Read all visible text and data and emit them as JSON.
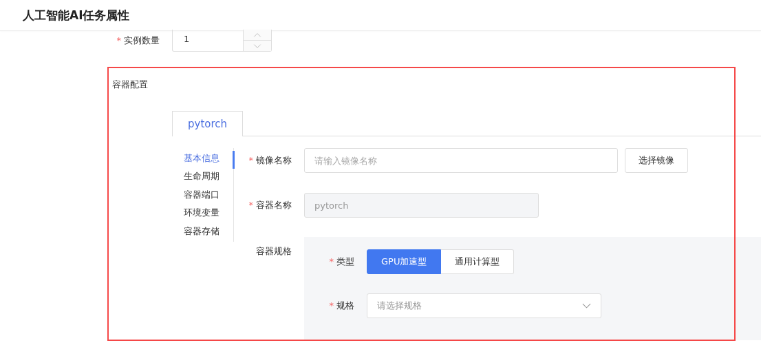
{
  "page_title": "人工智能AI任务属性",
  "instance_count": {
    "label": "实例数量",
    "required_mark": "*",
    "value": "1"
  },
  "container_config": {
    "label": "容器配置",
    "tabs": [
      {
        "label": "pytorch",
        "selected": true
      }
    ],
    "side_menu": [
      {
        "label": "基本信息",
        "selected": true
      },
      {
        "label": "生命周期",
        "selected": false
      },
      {
        "label": "容器端口",
        "selected": false
      },
      {
        "label": "环境变量",
        "selected": false
      },
      {
        "label": "容器存储",
        "selected": false
      }
    ],
    "image_name": {
      "label": "镜像名称",
      "required_mark": "*",
      "placeholder": "请输入镜像名称",
      "button": "选择镜像"
    },
    "container_name": {
      "label": "容器名称",
      "required_mark": "*",
      "value": "pytorch",
      "disabled": true
    },
    "spec": {
      "label": "容器规格",
      "type": {
        "label": "类型",
        "required_mark": "*",
        "options": [
          {
            "label": "GPU加速型",
            "selected": true
          },
          {
            "label": "通用计算型",
            "selected": false
          }
        ]
      },
      "size": {
        "label": "规格",
        "required_mark": "*",
        "placeholder": "请选择规格"
      }
    }
  }
}
